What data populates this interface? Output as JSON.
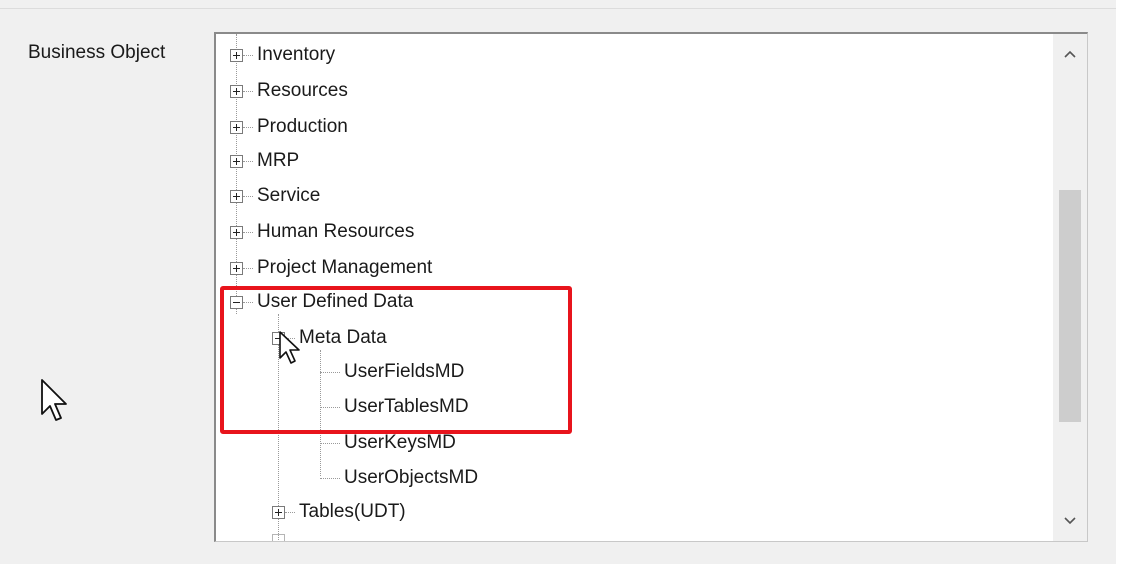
{
  "form": {
    "field_label": "Business Object"
  },
  "tree": {
    "nodes": [
      {
        "label": "Inventory",
        "state": "collapsed"
      },
      {
        "label": "Resources",
        "state": "collapsed"
      },
      {
        "label": "Production",
        "state": "collapsed"
      },
      {
        "label": "MRP",
        "state": "collapsed"
      },
      {
        "label": "Service",
        "state": "collapsed"
      },
      {
        "label": "Human Resources",
        "state": "collapsed"
      },
      {
        "label": "Project Management",
        "state": "collapsed"
      },
      {
        "label": "User Defined Data",
        "state": "expanded"
      },
      {
        "label": "Meta Data",
        "state": "expanded"
      },
      {
        "label": "UserFieldsMD",
        "state": "leaf"
      },
      {
        "label": "UserTablesMD",
        "state": "leaf"
      },
      {
        "label": "UserKeysMD",
        "state": "leaf"
      },
      {
        "label": "UserObjectsMD",
        "state": "leaf"
      },
      {
        "label": "Tables(UDT)",
        "state": "collapsed"
      }
    ]
  },
  "scrollbar": {
    "up_icon": "chevron-up-icon",
    "down_icon": "chevron-down-icon"
  },
  "colors": {
    "highlight": "#e8141c",
    "panel_background": "#f0f0f0"
  }
}
